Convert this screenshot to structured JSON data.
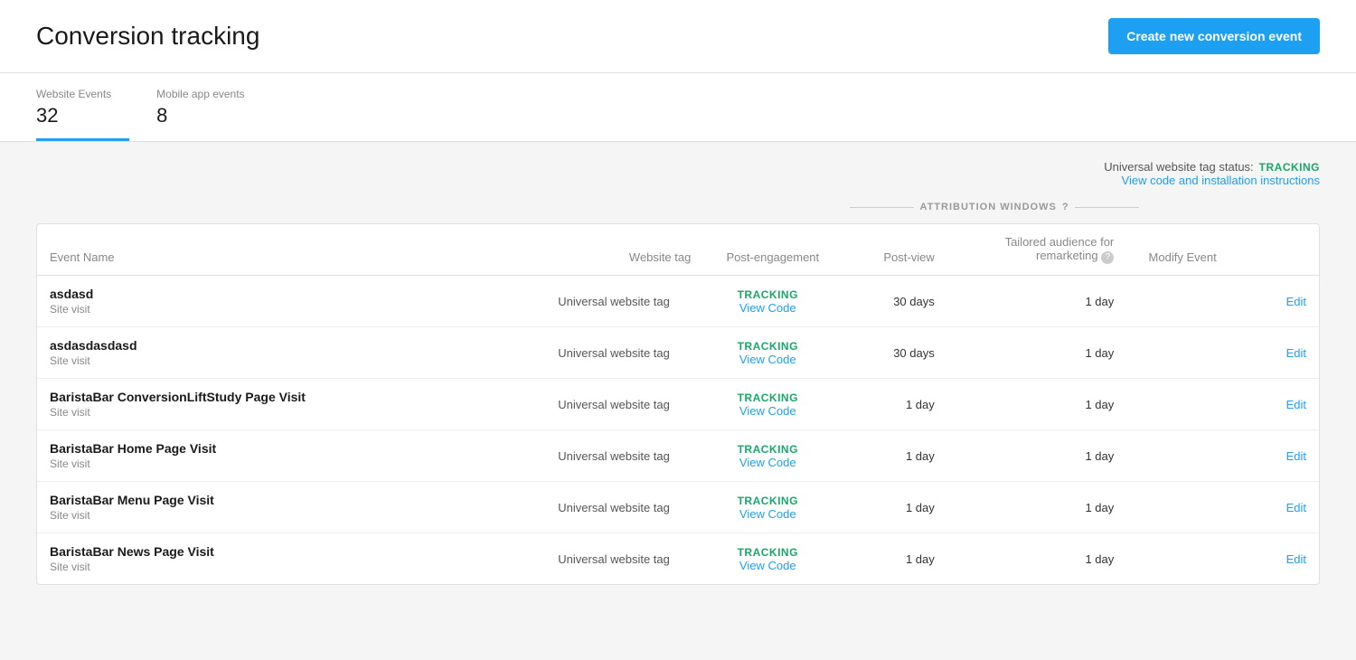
{
  "header": {
    "title": "Conversion tracking",
    "create_button_label": "Create new conversion event"
  },
  "tabs": [
    {
      "id": "website",
      "label": "Website Events",
      "count": "32",
      "active": true
    },
    {
      "id": "mobile",
      "label": "Mobile app events",
      "count": "8",
      "active": false
    }
  ],
  "tracking_info": {
    "status_label": "Universal website tag status:",
    "status_badge": "TRACKING",
    "view_code_label": "View code and installation instructions"
  },
  "attribution_windows": {
    "header_label": "ATTRIBUTION WINDOWS",
    "question_icon": "?"
  },
  "table": {
    "columns": {
      "event_name": "Event Name",
      "website_tag": "Website tag",
      "post_engagement": "Post-engagement",
      "post_view": "Post-view",
      "tailored_audience": "Tailored audience for remarketing",
      "modify_event": "Modify Event"
    },
    "rows": [
      {
        "name": "asdasd",
        "type": "Site visit",
        "tag": "Universal website tag",
        "tracking_status": "TRACKING",
        "view_code": "View Code",
        "post_engagement": "30 days",
        "post_view": "1 day",
        "tailored_audience": "",
        "edit": "Edit"
      },
      {
        "name": "asdasdasdasd",
        "type": "Site visit",
        "tag": "Universal website tag",
        "tracking_status": "TRACKING",
        "view_code": "View Code",
        "post_engagement": "30 days",
        "post_view": "1 day",
        "tailored_audience": "",
        "edit": "Edit"
      },
      {
        "name": "BaristaBar ConversionLiftStudy Page Visit",
        "type": "Site visit",
        "tag": "Universal website tag",
        "tracking_status": "TRACKING",
        "view_code": "View Code",
        "post_engagement": "1 day",
        "post_view": "1 day",
        "tailored_audience": "",
        "edit": "Edit"
      },
      {
        "name": "BaristaBar Home Page Visit",
        "type": "Site visit",
        "tag": "Universal website tag",
        "tracking_status": "TRACKING",
        "view_code": "View Code",
        "post_engagement": "1 day",
        "post_view": "1 day",
        "tailored_audience": "",
        "edit": "Edit"
      },
      {
        "name": "BaristaBar Menu Page Visit",
        "type": "Site visit",
        "tag": "Universal website tag",
        "tracking_status": "TRACKING",
        "view_code": "View Code",
        "post_engagement": "1 day",
        "post_view": "1 day",
        "tailored_audience": "",
        "edit": "Edit"
      },
      {
        "name": "BaristaBar News Page Visit",
        "type": "Site visit",
        "tag": "Universal website tag",
        "tracking_status": "TRACKING",
        "view_code": "View Code",
        "post_engagement": "1 day",
        "post_view": "1 day",
        "tailored_audience": "",
        "edit": "Edit"
      }
    ]
  },
  "colors": {
    "accent_blue": "#1da0f2",
    "tracking_green": "#17a869"
  }
}
